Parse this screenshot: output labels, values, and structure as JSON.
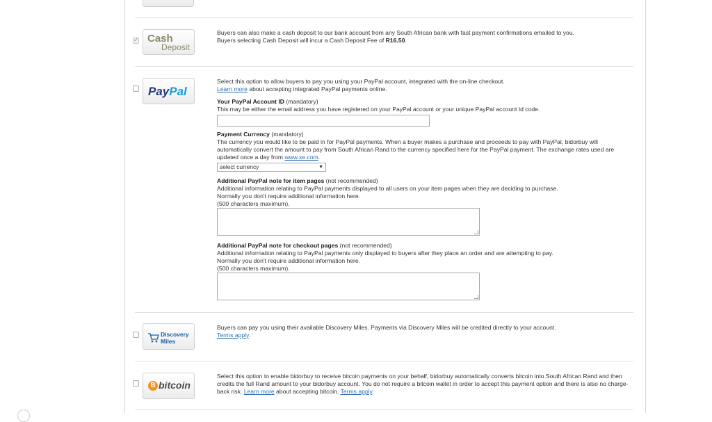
{
  "cash_deposit": {
    "logo_line1": "Cash",
    "logo_line2": "Deposit",
    "line1": "Buyers can also make a cash deposit to our bank account from any South African bank with fast payment confirmations emailed to you.",
    "line2_prefix": "Buyers selecting Cash Deposit will incur a Cash Deposit Fee of ",
    "fee": "R16.50",
    "line2_suffix": "."
  },
  "paypal": {
    "logo_pay": "Pay",
    "logo_pal": "Pal",
    "intro": "Select this option to allow buyers to pay you using your PayPal account, integrated with the on-line checkout.",
    "learn_more": "Learn more",
    "learn_more_suffix": " about accepting integrated PayPal payments online.",
    "account_id_label": "Your PayPal Account ID",
    "account_id_tag": " (mandatory)",
    "account_id_help": "This may be either the email address you have registered on your PayPal account or your unique PayPal account Id code.",
    "account_id_value": "",
    "currency_label": "Payment Currency",
    "currency_tag": " (mandatory)",
    "currency_help": "The currency you would like to be paid in for PayPal payments. When a buyer makes a purchase and proceeds to pay with PayPal, bidorbuy will automatically convert the amount to pay from South African Rand to the currency specified here for the PayPal payment. The exchange rates used are updated once a day from ",
    "xe_link": "www.xe.com",
    "currency_help_suffix": ".",
    "currency_selected": "select currency",
    "item_note_label": "Additional PayPal note for item pages",
    "item_note_tag": " (not recommended)",
    "item_note_help1": "Additional information relating to PayPal payments displayed to all users on your item pages when they are deciding to purchase.",
    "item_note_help2": "Normally you don't require additional information here.",
    "item_note_help3": "(500 characters maximum).",
    "checkout_note_label": "Additional PayPal note for checkout pages",
    "checkout_note_tag": " (not recommended)",
    "checkout_note_help1": "Additional information relating to PayPal payments only displayed to buyers after they place an order and are attempting to pay.",
    "checkout_note_help2": "Normally you don't require additional information here.",
    "checkout_note_help3": "(500 characters maximum)."
  },
  "discovery": {
    "logo_line1": "Discovery",
    "logo_line2": "Miles",
    "text": "Buyers can pay you using their available Discovery Miles. Payments via Discovery Miles will be credited directly to your account.",
    "terms": "Terms apply",
    "terms_suffix": "."
  },
  "bitcoin": {
    "logo_text": "bitcoin",
    "text": "Select this option to enable bidorbuy to receive bitcoin payments on your behalf, bidorbuy automatically converts bitcoin into South African Rand and then credits the full Rand amount to your bidorbuy account. You do not require a bitcoin wallet in order to accept this payment option and there is also no charge-back risk. ",
    "learn_more": "Learn more",
    "mid": " about accepting bitcoin. ",
    "terms": "Terms apply",
    "suffix": "."
  },
  "colors": {
    "link": "#2a6fb3",
    "paypal_dark": "#253b80",
    "paypal_light": "#179bd7",
    "bitcoin": "#f7931a",
    "discovery": "#1a5fa8"
  }
}
